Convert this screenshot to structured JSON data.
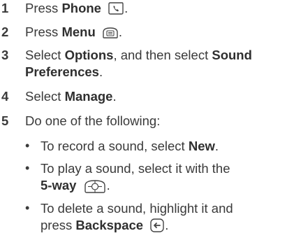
{
  "steps": [
    {
      "num": "1",
      "pre": "Press ",
      "bold": "Phone",
      "icon": "phone-button-icon",
      "post": "."
    },
    {
      "num": "2",
      "pre": "Press ",
      "bold": "Menu",
      "icon": "menu-button-icon",
      "post": "."
    },
    {
      "num": "3",
      "pre": "Select ",
      "bold": "Options",
      "mid": ", and then select ",
      "bold2": "Sound",
      "line2_bold": "Preferences",
      "post": "."
    },
    {
      "num": "4",
      "pre": "Select ",
      "bold": "Manage",
      "post": "."
    },
    {
      "num": "5",
      "text": "Do one of the following:"
    }
  ],
  "substeps": [
    {
      "pre": "To record a sound, select ",
      "bold": "New",
      "post": "."
    },
    {
      "line1": "To play a sound, select it with the",
      "bold": "5-way",
      "icon": "five-way-navigator-icon",
      "post": "."
    },
    {
      "line1": "To delete a sound, highlight it and",
      "pre": "press ",
      "bold": "Backspace",
      "icon": "backspace-button-icon",
      "post": "."
    }
  ]
}
